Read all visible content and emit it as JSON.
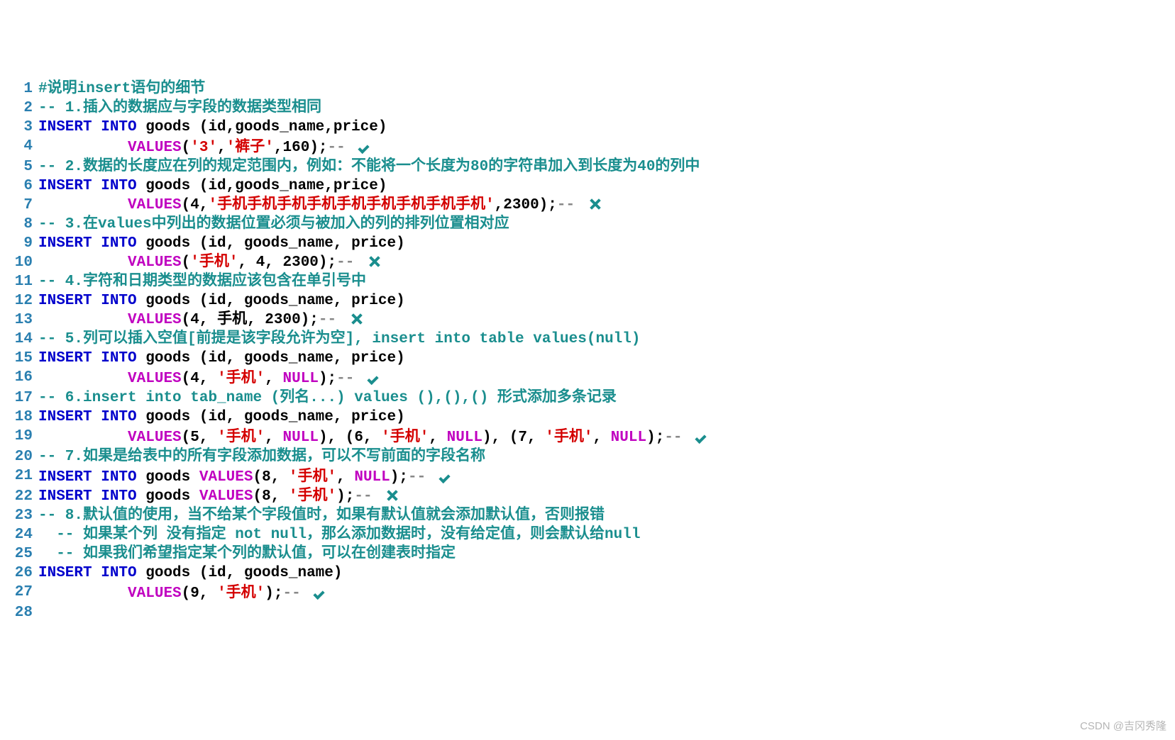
{
  "watermark": "CSDN @吉冈秀隆",
  "lines": [
    {
      "n": 1,
      "segs": [
        {
          "cls": "c-teal",
          "t": "#说明insert语句的细节"
        }
      ]
    },
    {
      "n": 2,
      "segs": [
        {
          "cls": "c-teal",
          "t": "-- 1.插入的数据应与字段的数据类型相同"
        }
      ]
    },
    {
      "n": 3,
      "segs": [
        {
          "cls": "c-blue",
          "t": "INSERT INTO "
        },
        {
          "cls": "c-black",
          "t": "goods (id,goods_name,price)"
        }
      ]
    },
    {
      "n": 4,
      "segs": [
        {
          "cls": "",
          "t": "          "
        },
        {
          "cls": "c-magenta",
          "t": "VALUES"
        },
        {
          "cls": "c-black",
          "t": "("
        },
        {
          "cls": "c-red",
          "t": "'3'"
        },
        {
          "cls": "c-black",
          "t": ","
        },
        {
          "cls": "c-red",
          "t": "'裤子'"
        },
        {
          "cls": "c-black",
          "t": ",160);"
        },
        {
          "cls": "c-gray",
          "t": "-- "
        }
      ],
      "icon": "check"
    },
    {
      "n": 5,
      "segs": [
        {
          "cls": "c-teal",
          "t": "-- 2.数据的长度应在列的规定范围内，例如：不能将一个长度为80的字符串加入到长度为40的列中"
        }
      ]
    },
    {
      "n": 6,
      "segs": [
        {
          "cls": "c-blue",
          "t": "INSERT INTO "
        },
        {
          "cls": "c-black",
          "t": "goods (id,goods_name,price)"
        }
      ]
    },
    {
      "n": 7,
      "segs": [
        {
          "cls": "",
          "t": "          "
        },
        {
          "cls": "c-magenta",
          "t": "VALUES"
        },
        {
          "cls": "c-black",
          "t": "(4,"
        },
        {
          "cls": "c-red",
          "t": "'手机手机手机手机手机手机手机手机手机'"
        },
        {
          "cls": "c-black",
          "t": ",2300);"
        },
        {
          "cls": "c-gray",
          "t": "-- "
        }
      ],
      "icon": "cross"
    },
    {
      "n": 8,
      "segs": [
        {
          "cls": "c-teal",
          "t": "-- 3.在values中列出的数据位置必须与被加入的列的排列位置相对应"
        }
      ]
    },
    {
      "n": 9,
      "segs": [
        {
          "cls": "c-blue",
          "t": "INSERT INTO "
        },
        {
          "cls": "c-black",
          "t": "goods (id, goods_name, price)"
        }
      ]
    },
    {
      "n": 10,
      "segs": [
        {
          "cls": "",
          "t": "          "
        },
        {
          "cls": "c-magenta",
          "t": "VALUES"
        },
        {
          "cls": "c-black",
          "t": "("
        },
        {
          "cls": "c-red",
          "t": "'手机'"
        },
        {
          "cls": "c-black",
          "t": ", 4, 2300);"
        },
        {
          "cls": "c-gray",
          "t": "-- "
        }
      ],
      "icon": "cross"
    },
    {
      "n": 11,
      "segs": [
        {
          "cls": "c-teal",
          "t": "-- 4.字符和日期类型的数据应该包含在单引号中"
        }
      ]
    },
    {
      "n": 12,
      "segs": [
        {
          "cls": "c-blue",
          "t": "INSERT INTO "
        },
        {
          "cls": "c-black",
          "t": "goods (id, goods_name, price)"
        }
      ]
    },
    {
      "n": 13,
      "segs": [
        {
          "cls": "",
          "t": "          "
        },
        {
          "cls": "c-magenta",
          "t": "VALUES"
        },
        {
          "cls": "c-black",
          "t": "(4, 手机, 2300);"
        },
        {
          "cls": "c-gray",
          "t": "-- "
        }
      ],
      "icon": "cross"
    },
    {
      "n": 14,
      "segs": [
        {
          "cls": "c-teal",
          "t": "-- 5.列可以插入空值[前提是该字段允许为空], insert into table values(null)"
        }
      ]
    },
    {
      "n": 15,
      "segs": [
        {
          "cls": "c-blue",
          "t": "INSERT INTO "
        },
        {
          "cls": "c-black",
          "t": "goods (id, goods_name, price)"
        }
      ]
    },
    {
      "n": 16,
      "segs": [
        {
          "cls": "",
          "t": "          "
        },
        {
          "cls": "c-magenta",
          "t": "VALUES"
        },
        {
          "cls": "c-black",
          "t": "(4, "
        },
        {
          "cls": "c-red",
          "t": "'手机'"
        },
        {
          "cls": "c-black",
          "t": ", "
        },
        {
          "cls": "c-magenta",
          "t": "NULL"
        },
        {
          "cls": "c-black",
          "t": ");"
        },
        {
          "cls": "c-gray",
          "t": "-- "
        }
      ],
      "icon": "check"
    },
    {
      "n": 17,
      "segs": [
        {
          "cls": "c-teal",
          "t": "-- 6.insert into tab_name (列名...) values (),(),() 形式添加多条记录"
        }
      ]
    },
    {
      "n": 18,
      "segs": [
        {
          "cls": "c-blue",
          "t": "INSERT INTO "
        },
        {
          "cls": "c-black",
          "t": "goods (id, goods_name, price)"
        }
      ]
    },
    {
      "n": 19,
      "segs": [
        {
          "cls": "",
          "t": "          "
        },
        {
          "cls": "c-magenta",
          "t": "VALUES"
        },
        {
          "cls": "c-black",
          "t": "(5, "
        },
        {
          "cls": "c-red",
          "t": "'手机'"
        },
        {
          "cls": "c-black",
          "t": ", "
        },
        {
          "cls": "c-magenta",
          "t": "NULL"
        },
        {
          "cls": "c-black",
          "t": "), (6, "
        },
        {
          "cls": "c-red",
          "t": "'手机'"
        },
        {
          "cls": "c-black",
          "t": ", "
        },
        {
          "cls": "c-magenta",
          "t": "NULL"
        },
        {
          "cls": "c-black",
          "t": "), (7, "
        },
        {
          "cls": "c-red",
          "t": "'手机'"
        },
        {
          "cls": "c-black",
          "t": ", "
        },
        {
          "cls": "c-magenta",
          "t": "NULL"
        },
        {
          "cls": "c-black",
          "t": ");"
        },
        {
          "cls": "c-gray",
          "t": "-- "
        }
      ],
      "icon": "check"
    },
    {
      "n": 20,
      "segs": [
        {
          "cls": "c-teal",
          "t": "-- 7.如果是给表中的所有字段添加数据，可以不写前面的字段名称"
        }
      ]
    },
    {
      "n": 21,
      "segs": [
        {
          "cls": "c-blue",
          "t": "INSERT INTO "
        },
        {
          "cls": "c-black",
          "t": "goods "
        },
        {
          "cls": "c-magenta",
          "t": "VALUES"
        },
        {
          "cls": "c-black",
          "t": "(8, "
        },
        {
          "cls": "c-red",
          "t": "'手机'"
        },
        {
          "cls": "c-black",
          "t": ", "
        },
        {
          "cls": "c-magenta",
          "t": "NULL"
        },
        {
          "cls": "c-black",
          "t": ");"
        },
        {
          "cls": "c-gray",
          "t": "-- "
        }
      ],
      "icon": "check"
    },
    {
      "n": 22,
      "segs": [
        {
          "cls": "c-blue",
          "t": "INSERT INTO "
        },
        {
          "cls": "c-black",
          "t": "goods "
        },
        {
          "cls": "c-magenta",
          "t": "VALUES"
        },
        {
          "cls": "c-black",
          "t": "(8, "
        },
        {
          "cls": "c-red",
          "t": "'手机'"
        },
        {
          "cls": "c-black",
          "t": ");"
        },
        {
          "cls": "c-gray",
          "t": "-- "
        }
      ],
      "icon": "cross"
    },
    {
      "n": 23,
      "segs": [
        {
          "cls": "c-teal",
          "t": "-- 8.默认值的使用，当不给某个字段值时，如果有默认值就会添加默认值，否则报错"
        }
      ]
    },
    {
      "n": 24,
      "segs": [
        {
          "cls": "c-teal",
          "t": "  -- 如果某个列 没有指定 not null，那么添加数据时，没有给定值，则会默认给null"
        }
      ]
    },
    {
      "n": 25,
      "segs": [
        {
          "cls": "c-teal",
          "t": "  -- 如果我们希望指定某个列的默认值，可以在创建表时指定"
        }
      ]
    },
    {
      "n": 26,
      "segs": [
        {
          "cls": "c-blue",
          "t": "INSERT INTO "
        },
        {
          "cls": "c-black",
          "t": "goods (id, goods_name)"
        }
      ]
    },
    {
      "n": 27,
      "segs": [
        {
          "cls": "",
          "t": "          "
        },
        {
          "cls": "c-magenta",
          "t": "VALUES"
        },
        {
          "cls": "c-black",
          "t": "(9, "
        },
        {
          "cls": "c-red",
          "t": "'手机'"
        },
        {
          "cls": "c-black",
          "t": ");"
        },
        {
          "cls": "c-gray",
          "t": "-- "
        }
      ],
      "icon": "check"
    },
    {
      "n": 28,
      "segs": []
    }
  ]
}
